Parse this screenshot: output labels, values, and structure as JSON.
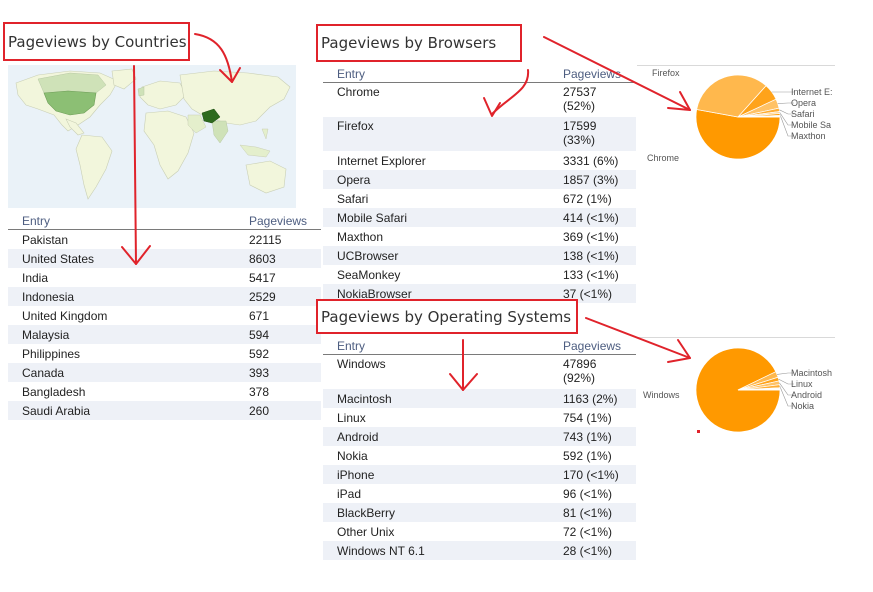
{
  "countries": {
    "title": "Pageviews by Countries",
    "col_entry": "Entry",
    "col_pageviews": "Pageviews",
    "rows": [
      {
        "entry": "Pakistan",
        "views": "22115"
      },
      {
        "entry": "United States",
        "views": "8603"
      },
      {
        "entry": "India",
        "views": "5417"
      },
      {
        "entry": "Indonesia",
        "views": "2529"
      },
      {
        "entry": "United Kingdom",
        "views": "671"
      },
      {
        "entry": "Malaysia",
        "views": "594"
      },
      {
        "entry": "Philippines",
        "views": "592"
      },
      {
        "entry": "Canada",
        "views": "393"
      },
      {
        "entry": "Bangladesh",
        "views": "378"
      },
      {
        "entry": "Saudi Arabia",
        "views": "260"
      }
    ]
  },
  "browsers": {
    "title": "Pageviews by Browsers",
    "col_entry": "Entry",
    "col_pageviews": "Pageviews",
    "rows": [
      {
        "entry": "Chrome",
        "views": "27537",
        "pct": "(52%)"
      },
      {
        "entry": "Firefox",
        "views": "17599",
        "pct": "(33%)"
      },
      {
        "entry": "Internet Explorer",
        "views": "3331 (6%)"
      },
      {
        "entry": "Opera",
        "views": "1857 (3%)"
      },
      {
        "entry": "Safari",
        "views": "672 (1%)"
      },
      {
        "entry": "Mobile Safari",
        "views": "414 (<1%)"
      },
      {
        "entry": "Maxthon",
        "views": "369 (<1%)"
      },
      {
        "entry": "UCBrowser",
        "views": "138 (<1%)"
      },
      {
        "entry": "SeaMonkey",
        "views": "133 (<1%)"
      },
      {
        "entry": "NokiaBrowser",
        "views": "37 (<1%)"
      }
    ],
    "pie_labels": {
      "firefox": "Firefox",
      "chrome": "Chrome",
      "internet_explorer": "Internet E:",
      "opera": "Opera",
      "safari": "Safari",
      "mobile_safari": "Mobile Sa",
      "maxthon": "Maxthon"
    }
  },
  "os": {
    "title": "Pageviews by Operating Systems",
    "col_entry": "Entry",
    "col_pageviews": "Pageviews",
    "rows": [
      {
        "entry": "Windows",
        "views": "47896",
        "pct": "(92%)"
      },
      {
        "entry": "Macintosh",
        "views": "1163 (2%)"
      },
      {
        "entry": "Linux",
        "views": "754 (1%)"
      },
      {
        "entry": "Android",
        "views": "743 (1%)"
      },
      {
        "entry": "Nokia",
        "views": "592 (1%)"
      },
      {
        "entry": "iPhone",
        "views": "170 (<1%)"
      },
      {
        "entry": "iPad",
        "views": "96 (<1%)"
      },
      {
        "entry": "BlackBerry",
        "views": "81 (<1%)"
      },
      {
        "entry": "Other Unix",
        "views": "72 (<1%)"
      },
      {
        "entry": "Windows NT 6.1",
        "views": "28 (<1%)"
      }
    ],
    "pie_labels": {
      "windows": "Windows",
      "macintosh": "Macintosh",
      "linux": "Linux",
      "android": "Android",
      "nokia": "Nokia"
    }
  },
  "colors": {
    "annotation_red": "#e0232b",
    "pie_orange": "#ff9900",
    "pie_orange_light": "#ffb84d",
    "map_water": "#eaf2f8",
    "map_land": "#f2f6dc",
    "map_highlight_dark": "#2d6a1e",
    "map_highlight_mid": "#8cbf74",
    "header_blue": "#4d5d80",
    "row_alt": "#eef1f7"
  }
}
